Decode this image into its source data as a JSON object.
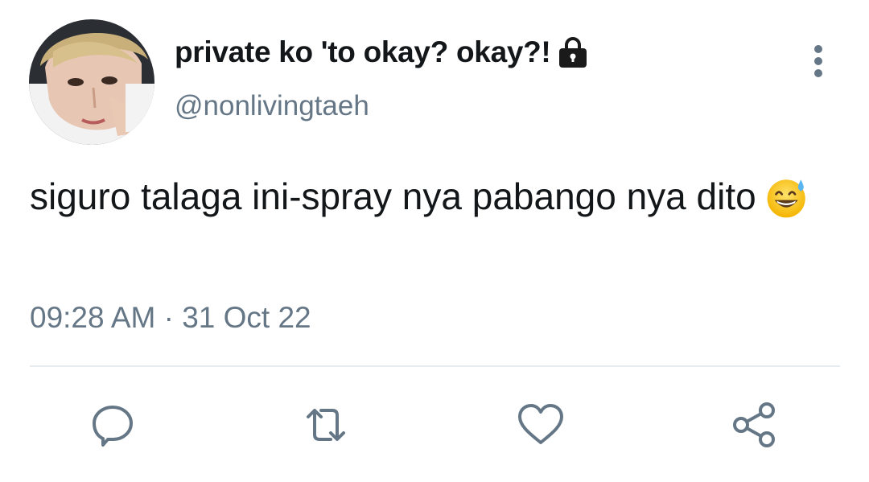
{
  "tweet": {
    "display_name": "private ko 'to okay? okay?!",
    "handle": "@nonlivingtaeh",
    "text": "siguro talaga ini-spray nya pabango nya dito",
    "emoji": "grinning-face-with-sweat",
    "timestamp": "09:28 AM · 31 Oct 22",
    "protected": true
  },
  "icons": {
    "lock": "lock-icon",
    "more": "more-vertical-icon",
    "reply": "reply-icon",
    "retweet": "retweet-icon",
    "like": "like-heart-icon",
    "share": "share-icon"
  },
  "colors": {
    "text": "#14171a",
    "secondary": "#657786",
    "divider": "#e6ecf0",
    "icon": "#657786"
  }
}
